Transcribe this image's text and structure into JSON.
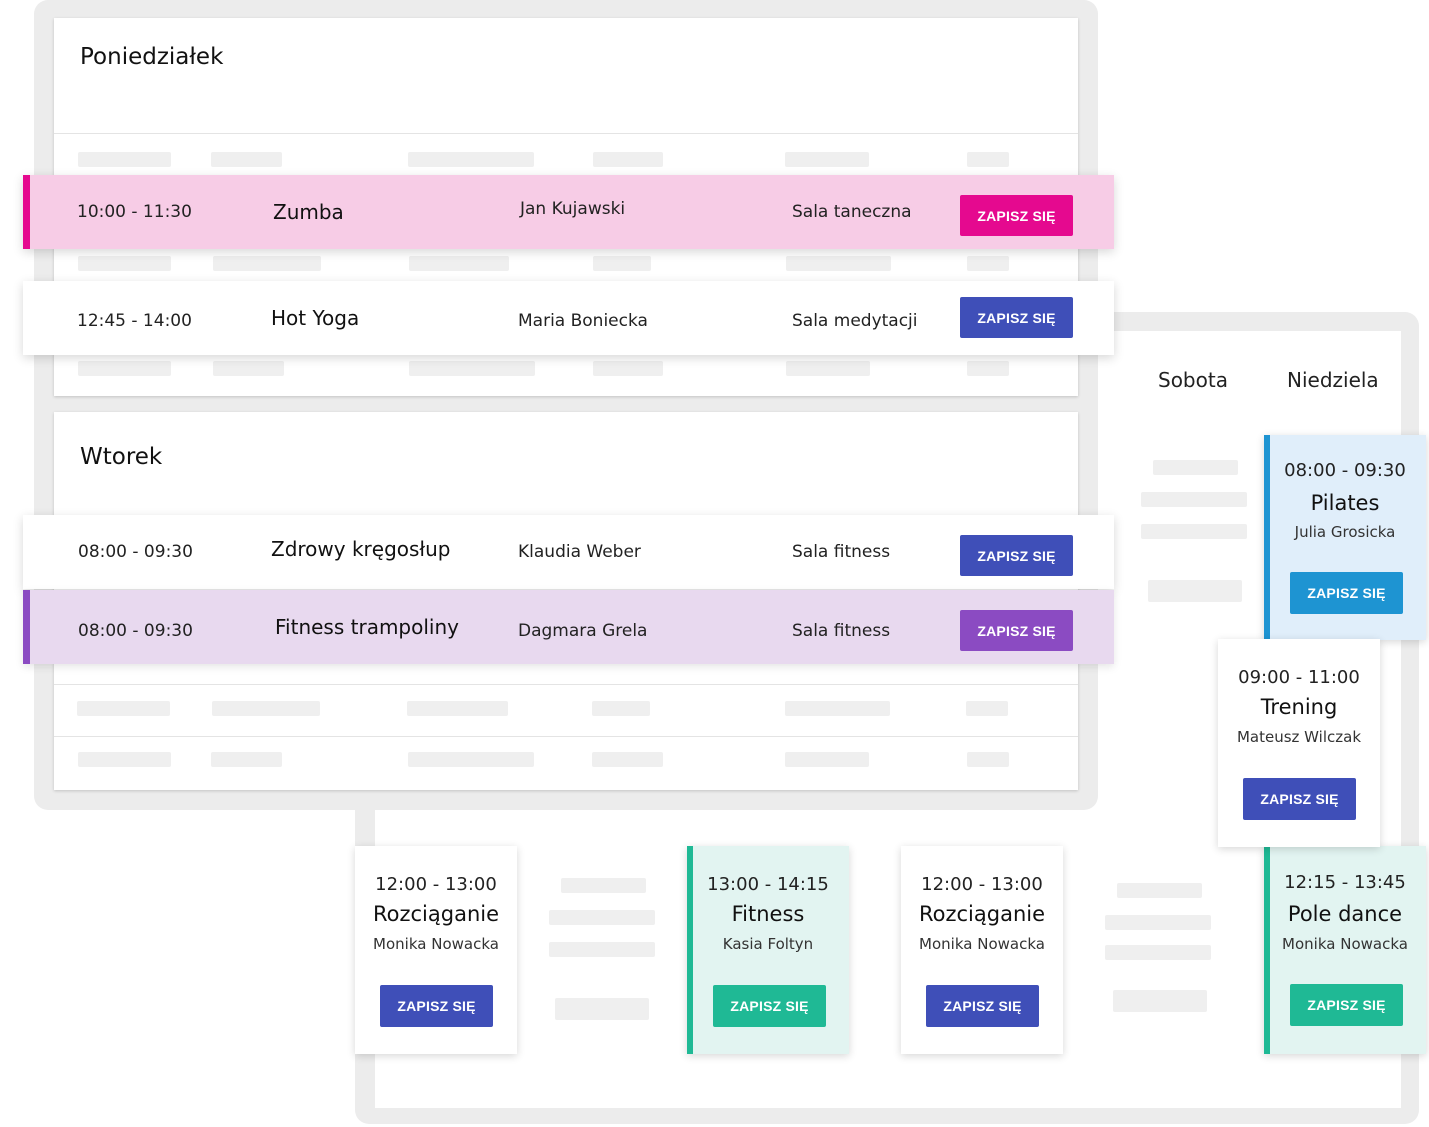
{
  "colors": {
    "indigo": "#3f4fb8",
    "magenta": "#e5098f",
    "purple": "#8b4bc2",
    "blue": "#1e94d2",
    "teal": "#1fb995"
  },
  "button_label": "ZAPISZ SIĘ",
  "monday": {
    "title": "Poniedziałek",
    "rows": [
      {
        "time": "10:00 - 11:30",
        "name": "Zumba",
        "coach": "Jan Kujawski",
        "room": "Sala taneczna",
        "button": "ZAPISZ SIĘ"
      },
      {
        "time": "12:45 - 14:00",
        "name": "Hot Yoga",
        "coach": "Maria Boniecka",
        "room": "Sala medytacji",
        "button": "ZAPISZ SIĘ"
      }
    ]
  },
  "tuesday": {
    "title": "Wtorek",
    "rows": [
      {
        "time": "08:00 - 09:30",
        "name": "Zdrowy kręgosłup",
        "coach": "Klaudia Weber",
        "room": "Sala fitness",
        "button": "ZAPISZ SIĘ"
      },
      {
        "time": "08:00 - 09:30",
        "name": "Fitness trampoliny",
        "coach": "Dagmara Grela",
        "room": "Sala fitness",
        "button": "ZAPISZ SIĘ"
      }
    ]
  },
  "week": {
    "headers": {
      "saturday": "Sobota",
      "sunday": "Niedziela"
    },
    "cards": [
      {
        "time": "08:00 - 09:30",
        "name": "Pilates",
        "coach": "Julia Grosicka",
        "button": "ZAPISZ SIĘ"
      },
      {
        "time": "09:00 - 11:00",
        "name": "Trening",
        "coach": "Mateusz Wilczak",
        "button": "ZAPISZ SIĘ"
      },
      {
        "time": "12:00 - 13:00",
        "name": "Rozciąganie",
        "coach": "Monika Nowacka",
        "button": "ZAPISZ SIĘ"
      },
      {
        "time": "13:00 - 14:15",
        "name": "Fitness",
        "coach": "Kasia Foltyn",
        "button": "ZAPISZ SIĘ"
      },
      {
        "time": "12:00 - 13:00",
        "name": "Rozciąganie",
        "coach": "Monika Nowacka",
        "button": "ZAPISZ SIĘ"
      },
      {
        "time": "12:15 - 13:45",
        "name": "Pole dance",
        "coach": "Monika Nowacka",
        "button": "ZAPISZ SIĘ"
      }
    ]
  }
}
